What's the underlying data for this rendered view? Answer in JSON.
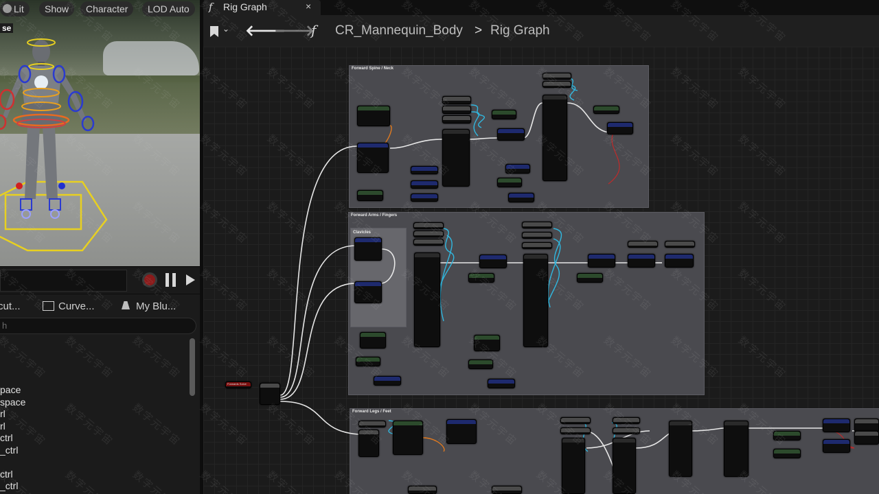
{
  "viewport": {
    "buttons": [
      "Lit",
      "Show",
      "Character",
      "LOD Auto"
    ],
    "corner_label": "se"
  },
  "left_panel": {
    "tabs": [
      "cut...",
      "Curve...",
      "My Blu..."
    ],
    "search_placeholder": "h",
    "items": [
      "pace",
      "space",
      "rl",
      "rl",
      "ctrl",
      "_ctrl",
      "",
      "ctrl",
      "_ctrl"
    ]
  },
  "document_tab": {
    "label": "Rig Graph",
    "close": "×"
  },
  "toolbar": {
    "asset": "CR_Mannequin_Body",
    "separator": ">",
    "graph": "Rig Graph"
  },
  "graph": {
    "comments": [
      "Forward Spine / Neck",
      "Forward Arms / Fingers",
      "Clavicles",
      "Forward Legs / Feet"
    ],
    "event_node": "Forwards Solve"
  },
  "watermark": "数字元宇宙"
}
